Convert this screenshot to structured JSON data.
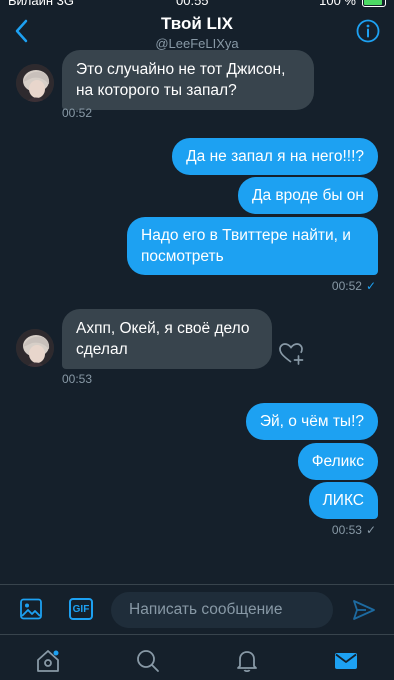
{
  "status_bar": {
    "carrier": "Билайн 3G",
    "time": "00:55",
    "battery": "100 %"
  },
  "header": {
    "title": "Твой LIX",
    "handle": "@LeeFeLIXya"
  },
  "messages": [
    {
      "text": "Это случайно не тот Джисон, на которого ты запал?",
      "time": "00:52"
    },
    {
      "text": "Да не запал я на него!!!?"
    },
    {
      "text": "Да вроде бы он"
    },
    {
      "text": "Надо его в Твиттере найти, и посмотреть",
      "time": "00:52",
      "status": "✓"
    },
    {
      "text": "Ахпп, Окей, я своё дело сделал",
      "time": "00:53"
    },
    {
      "text": "Эй, о чём ты!?"
    },
    {
      "text": "Феликс"
    },
    {
      "text": "ЛИКС",
      "time": "00:53",
      "status": "✓"
    }
  ],
  "composer": {
    "placeholder": "Написать сообщение",
    "gif_label": "GIF"
  },
  "colors": {
    "background": "#15202b",
    "accent": "#1da1f2",
    "incoming_bubble": "#38444d",
    "muted_text": "#8899a6"
  },
  "icons": {
    "back": "chevron-left-icon",
    "info": "info-icon",
    "like": "heart-plus-icon",
    "image": "image-icon",
    "gif": "gif-icon",
    "send": "send-icon",
    "home": "home-icon",
    "search": "search-icon",
    "notifications": "bell-icon",
    "messages": "mail-icon"
  }
}
